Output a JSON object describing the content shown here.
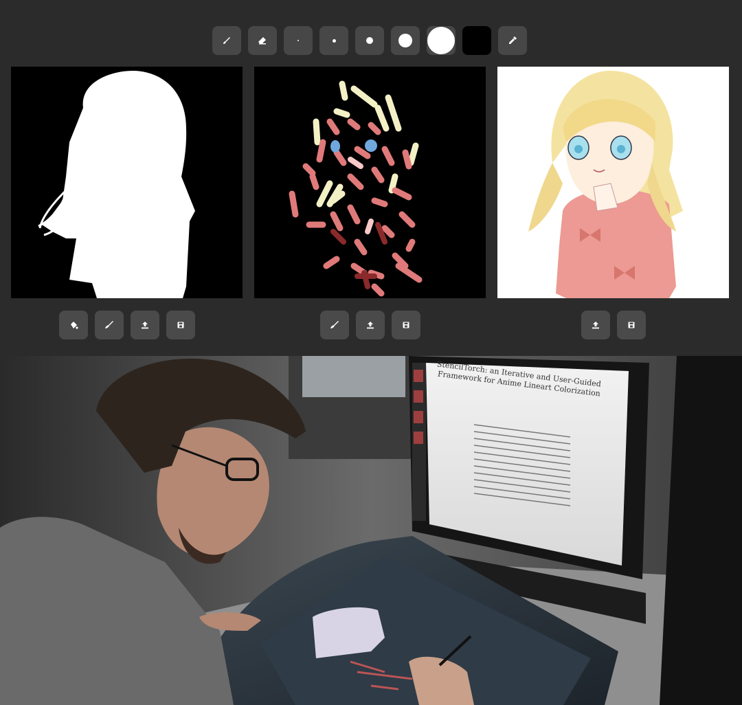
{
  "toolbar": {
    "tools": [
      {
        "name": "brush-tool",
        "icon": "brush-icon"
      },
      {
        "name": "eraser-tool",
        "icon": "eraser-icon"
      }
    ],
    "brush_sizes": [
      "xs",
      "s",
      "m",
      "l",
      "xl"
    ],
    "selected_color": "#000000",
    "color_picker_icon": "eyedropper-icon"
  },
  "panels": [
    {
      "name": "mask-panel",
      "content": "white silhouette mask on black",
      "actions": [
        "fill-icon",
        "brush-icon",
        "upload-icon",
        "save-icon"
      ]
    },
    {
      "name": "hints-panel",
      "content": "colored stroke hints on black",
      "actions": [
        "brush-icon",
        "upload-icon",
        "save-icon"
      ]
    },
    {
      "name": "result-panel",
      "content": "colorized anime illustration",
      "actions": [
        "upload-icon",
        "save-icon"
      ]
    }
  ],
  "photo": {
    "paper_title": "StencilTorch: an Iterative and User-Guided Framework for Anime Lineart Colorization"
  },
  "colors": {
    "app_bg": "#2b2b2b",
    "button_bg": "#474747",
    "hint_pink": "#e07a7a",
    "hint_cream": "#f4f0c6",
    "hint_blue": "#6fa8dc",
    "hint_darkred": "#8b2a2a"
  }
}
